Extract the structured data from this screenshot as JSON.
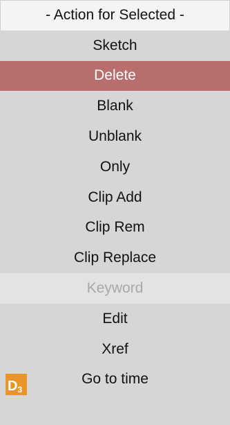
{
  "menu": {
    "header": "- Action for Selected -",
    "items": [
      {
        "label": "Sketch",
        "state": "normal"
      },
      {
        "label": "Delete",
        "state": "selected"
      },
      {
        "label": "Blank",
        "state": "normal"
      },
      {
        "label": "Unblank",
        "state": "normal"
      },
      {
        "label": "Only",
        "state": "normal"
      },
      {
        "label": "Clip Add",
        "state": "normal"
      },
      {
        "label": "Clip Rem",
        "state": "normal"
      },
      {
        "label": "Clip Replace",
        "state": "normal"
      },
      {
        "label": "Keyword",
        "state": "disabled"
      },
      {
        "label": "Edit",
        "state": "normal"
      },
      {
        "label": "Xref",
        "state": "normal"
      },
      {
        "label": "Go to time",
        "state": "normal"
      }
    ]
  },
  "badge": {
    "main": "D",
    "sub": "3",
    "icon": "d3-badge-icon"
  },
  "colors": {
    "menu_bg": "#d6d6d6",
    "header_bg": "#f4f4f4",
    "selected_bg": "#b96e6e",
    "disabled_bg": "#e3e3e3",
    "disabled_text": "#a8a8a8",
    "badge_bg": "#e8952a"
  }
}
